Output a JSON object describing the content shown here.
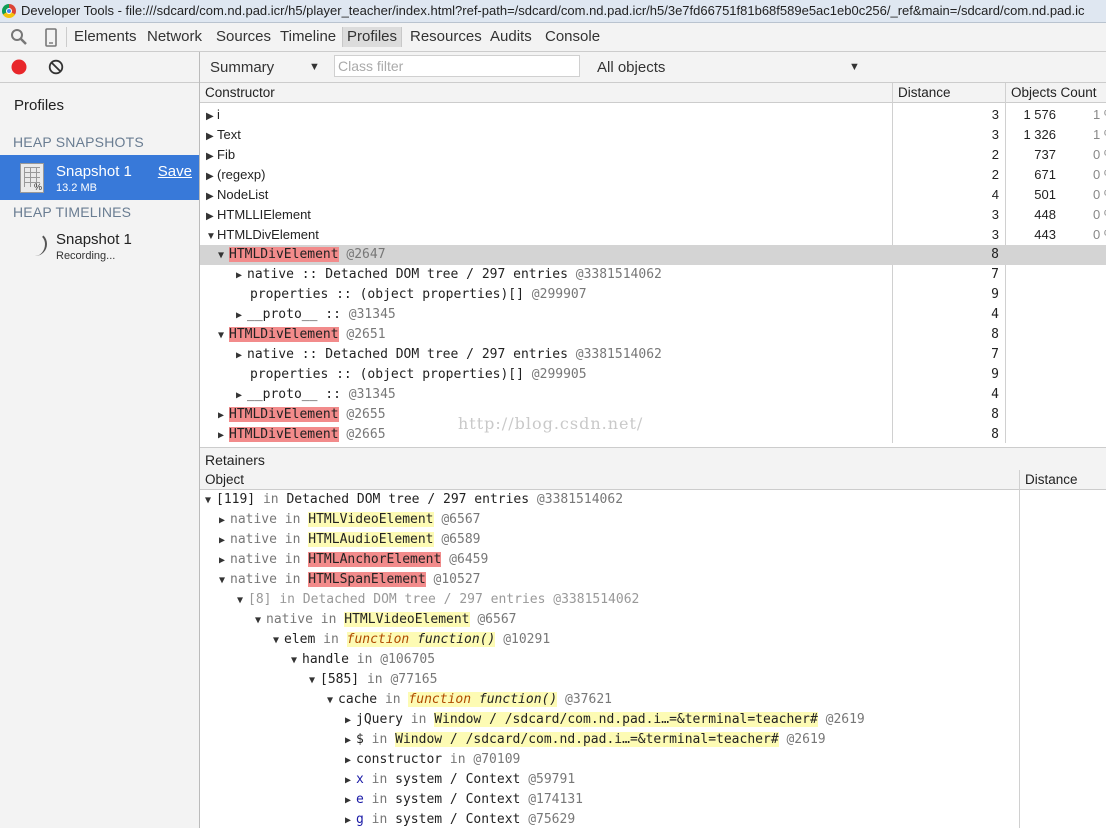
{
  "window": {
    "title": "Developer Tools - file:///sdcard/com.nd.pad.icr/h5/player_teacher/index.html?ref-path=/sdcard/com.nd.pad.icr/h5/3e7fd66751f81b68f589e5ac1eb0c256/_ref&main=/sdcard/com.nd.pad.ic"
  },
  "toolbar": {
    "tabs": [
      "Elements",
      "Network",
      "Sources",
      "Timeline",
      "Profiles",
      "Resources",
      "Audits",
      "Console"
    ],
    "active_tab": "Profiles"
  },
  "sidebar": {
    "profiles_label": "Profiles",
    "heap_snapshots_title": "HEAP SNAPSHOTS",
    "snapshot": {
      "name": "Snapshot 1",
      "size": "13.2 MB",
      "save_label": "Save"
    },
    "heap_timelines_title": "HEAP TIMELINES",
    "timeline": {
      "name": "Snapshot 1",
      "status": "Recording..."
    }
  },
  "filterbar": {
    "view_select": "Summary",
    "class_filter_placeholder": "Class filter",
    "objects_select": "All objects"
  },
  "summary_grid": {
    "headers": {
      "constructor": "Constructor",
      "distance": "Distance",
      "objects_count": "Objects Count"
    },
    "rows": [
      {
        "name": "i",
        "distance": "3",
        "count": "1 576",
        "pct": "1 %"
      },
      {
        "name": "Text",
        "distance": "3",
        "count": "1 326",
        "pct": "1 %"
      },
      {
        "name": "Fib",
        "distance": "2",
        "count": "737",
        "pct": "0 %"
      },
      {
        "name": "(regexp)",
        "distance": "2",
        "count": "671",
        "pct": "0 %"
      },
      {
        "name": "NodeList",
        "distance": "4",
        "count": "501",
        "pct": "0 %"
      },
      {
        "name": "HTMLLIElement",
        "distance": "3",
        "count": "448",
        "pct": "0 %"
      },
      {
        "name": "HTMLDivElement",
        "distance": "3",
        "count": "443",
        "pct": "0 %"
      }
    ],
    "children": [
      {
        "name": "HTMLDivElement",
        "id": "@2647",
        "distance": "8"
      },
      {
        "prop": "native",
        "sep": "::",
        "desc": "Detached DOM tree / 297 entries",
        "id": "@3381514062",
        "distance": "7"
      },
      {
        "prop": "properties",
        "sep": "::",
        "desc": "(object properties)[]",
        "id": "@299907",
        "distance": "9"
      },
      {
        "prop": "__proto__",
        "sep": "::",
        "id": "@31345",
        "distance": "4"
      },
      {
        "name": "HTMLDivElement",
        "id": "@2651",
        "distance": "8"
      },
      {
        "prop": "native",
        "sep": "::",
        "desc": "Detached DOM tree / 297 entries",
        "id": "@3381514062",
        "distance": "7"
      },
      {
        "prop": "properties",
        "sep": "::",
        "desc": "(object properties)[]",
        "id": "@299905",
        "distance": "9"
      },
      {
        "prop": "__proto__",
        "sep": "::",
        "id": "@31345",
        "distance": "4"
      },
      {
        "name": "HTMLDivElement",
        "id": "@2655",
        "distance": "8"
      },
      {
        "name": "HTMLDivElement",
        "id": "@2665",
        "distance": "8"
      }
    ]
  },
  "watermark": "http://blog.csdn.net/",
  "retainers": {
    "title": "Retainers",
    "headers": {
      "object": "Object",
      "distance": "Distance"
    },
    "rows": [
      {
        "a": "[119]",
        "in": "in",
        "b": "Detached DOM tree / 297 entries",
        "id": "@3381514062"
      },
      {
        "a": "native",
        "in": "in",
        "b": "HTMLVideoElement",
        "id": "@6567"
      },
      {
        "a": "native",
        "in": "in",
        "b": "HTMLAudioElement",
        "id": "@6589"
      },
      {
        "a": "native",
        "in": "in",
        "b": "HTMLAnchorElement",
        "id": "@6459"
      },
      {
        "a": "native",
        "in": "in",
        "b": "HTMLSpanElement",
        "id": "@10527"
      },
      {
        "a": "[8]",
        "in": "in",
        "b": "Detached DOM tree / 297 entries",
        "id": "@3381514062"
      },
      {
        "a": "native",
        "in": "in",
        "b": "HTMLVideoElement",
        "id": "@6567"
      },
      {
        "a": "elem",
        "in": "in",
        "b1": "function",
        "b2": "function()",
        "id": "@10291"
      },
      {
        "a": "handle",
        "in": "in",
        "id": "@106705"
      },
      {
        "a": "[585]",
        "in": "in",
        "id": "@77165"
      },
      {
        "a": "cache",
        "in": "in",
        "b1": "function",
        "b2": "function()",
        "id": "@37621"
      },
      {
        "a": "jQuery",
        "in": "in",
        "b": "Window / /sdcard/com.nd.pad.i…=&terminal=teacher#",
        "id": "@2619"
      },
      {
        "a": "$",
        "in": "in",
        "b": "Window / /sdcard/com.nd.pad.i…=&terminal=teacher#",
        "id": "@2619"
      },
      {
        "a": "constructor",
        "in": "in",
        "id": "@70109"
      },
      {
        "a": "x",
        "in": "in",
        "b": "system / Context",
        "id": "@59791"
      },
      {
        "a": "e",
        "in": "in",
        "b": "system / Context",
        "id": "@174131"
      },
      {
        "a": "g",
        "in": "in",
        "b": "system / Context",
        "id": "@75629"
      }
    ]
  }
}
